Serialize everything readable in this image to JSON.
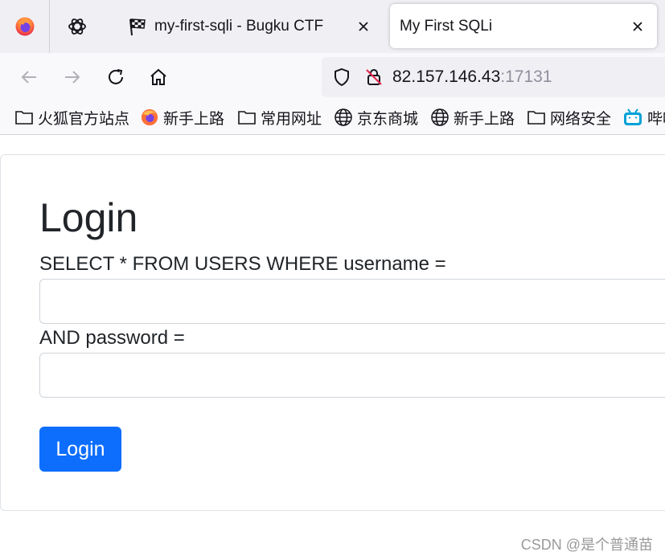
{
  "browser": {
    "tabs": [
      {
        "title": "my-first-sqli - Bugku CTF",
        "active": false
      },
      {
        "title": "My First SQLi",
        "active": true
      }
    ],
    "url": {
      "host": "82.157.146.43",
      "port": ":17131"
    },
    "bookmarks": [
      {
        "label": "火狐官方站点",
        "icon": "folder-icon"
      },
      {
        "label": "新手上路",
        "icon": "firefox-icon"
      },
      {
        "label": "常用网址",
        "icon": "folder-icon"
      },
      {
        "label": "京东商城",
        "icon": "globe-icon"
      },
      {
        "label": "新手上路",
        "icon": "globe-icon"
      },
      {
        "label": "网络安全",
        "icon": "folder-icon"
      },
      {
        "label": "哔哩",
        "icon": "bilibili-icon"
      }
    ]
  },
  "page": {
    "heading": "Login",
    "username_label": "SELECT * FROM USERS WHERE username =",
    "username_value": "",
    "password_label": "AND password =",
    "password_value": "",
    "submit_label": "Login"
  },
  "watermark": "CSDN @是个普通苗",
  "colors": {
    "primary": "#0d6efd",
    "tabstrip": "#f0f0f4",
    "toolbar": "#f9f9fb"
  }
}
